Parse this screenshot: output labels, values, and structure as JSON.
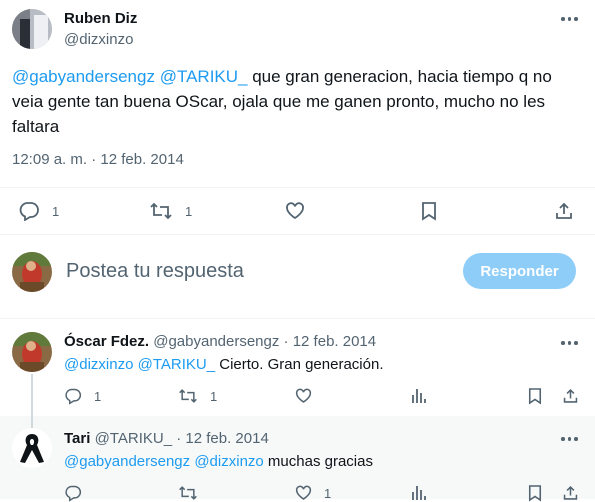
{
  "main_tweet": {
    "author_name": "Ruben Diz",
    "author_handle": "@dizxinzo",
    "mention1": "@gabyandersengz",
    "mention2": "@TARIKU_",
    "text_line1_rest": " que gran generacion, hacia tiempo q no",
    "text_line2": "veia gente tan buena OScar, ojala que me ganen pronto, mucho no les",
    "text_line3": "faltara",
    "timestamp": "12:09 a. m. · 12 feb. 2014",
    "reply_count": "1",
    "retweet_count": "1"
  },
  "composer": {
    "placeholder": "Postea tu respuesta",
    "reply_button": "Responder"
  },
  "reply1": {
    "author_name": "Óscar Fdez.",
    "author_handle": "@gabyandersengz",
    "date": " · 12 feb. 2014",
    "mention1": "@dizxinzo",
    "mention2": "@TARIKU_",
    "text_rest": " Cierto. Gran generación.",
    "reply_count": "1",
    "retweet_count": "1"
  },
  "reply2": {
    "author_name": "Tari",
    "author_handle": "@TARIKU_",
    "date": " · 12 feb. 2014",
    "mention1": "@gabyandersengz",
    "mention2": "@dizxinzo",
    "text_rest": " muchas gracias",
    "like_count": "1"
  },
  "colors": {
    "accent": "#1d9bf0",
    "reply_button_bg": "#8ecdf8",
    "muted": "#536471",
    "hover_bg": "#f7f9f9"
  }
}
